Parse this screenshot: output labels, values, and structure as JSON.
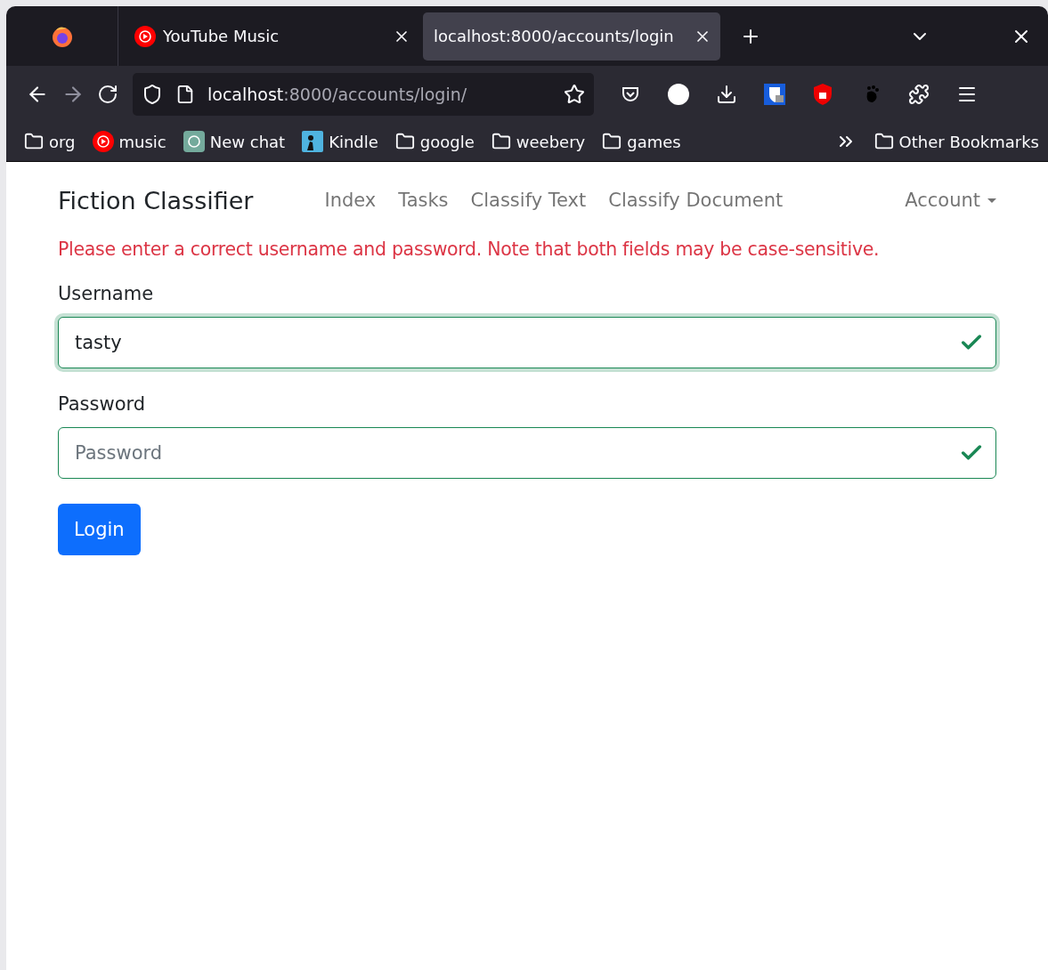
{
  "tabs": [
    {
      "title": "YouTube Music",
      "kind": "music",
      "selected": false
    },
    {
      "title": "localhost:8000/accounts/login",
      "kind": "none",
      "selected": true
    }
  ],
  "address": {
    "host": "localhost",
    "rest": ":8000/accounts/login/"
  },
  "bookmarks": [
    {
      "label": "org",
      "kind": "folder"
    },
    {
      "label": "music",
      "kind": "music"
    },
    {
      "label": "New chat",
      "kind": "chat"
    },
    {
      "label": "Kindle",
      "kind": "kindle"
    },
    {
      "label": "google",
      "kind": "folder"
    },
    {
      "label": "weebery",
      "kind": "folder"
    },
    {
      "label": "games",
      "kind": "folder"
    }
  ],
  "other_bookmarks": "Other Bookmarks",
  "navbar": {
    "brand": "Fiction Classifier",
    "links": [
      "Index",
      "Tasks",
      "Classify Text",
      "Classify Document"
    ],
    "account": "Account"
  },
  "error": "Please enter a correct username and password. Note that both fields may be case-sensitive.",
  "fields": [
    {
      "label": "Username",
      "value": "tasty",
      "valid": true,
      "focused": true
    },
    {
      "label": "Password",
      "placeholder": "Password",
      "valid": true,
      "focused": false
    }
  ],
  "submit": "Login"
}
